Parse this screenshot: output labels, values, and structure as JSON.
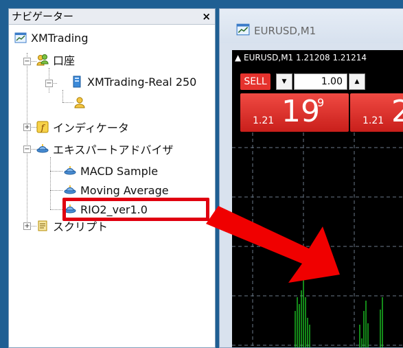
{
  "navigator": {
    "title": "ナビゲーター",
    "close": "×",
    "tree": [
      {
        "id": "xmtrading",
        "label": "XMTrading"
      },
      {
        "id": "accounts",
        "label": "口座"
      },
      {
        "id": "account-real",
        "label": "XMTrading-Real 250"
      },
      {
        "id": "indicators",
        "label": "インディケータ"
      },
      {
        "id": "expert-advisors",
        "label": "エキスパートアドバイザ"
      },
      {
        "id": "macd-sample",
        "label": "MACD Sample"
      },
      {
        "id": "moving-average",
        "label": "Moving Average"
      },
      {
        "id": "rio2",
        "label": "RIO2_ver1.0"
      },
      {
        "id": "scripts",
        "label": "スクリプト"
      }
    ]
  },
  "chart": {
    "window_title": "EURUSD,M1",
    "symbol_line": "▲ EURUSD,M1  1.21208 1.21214",
    "sell_label": "SELL",
    "lot_value": "1.00",
    "sell_price_prefix": "1.21",
    "sell_price_big": "19",
    "sell_price_sup": "9",
    "buy_price_prefix": "1.21",
    "buy_price_big": "2"
  },
  "colors": {
    "highlight": "#e00010",
    "trade_button": "#e5322d",
    "candles": "#22e52a"
  }
}
